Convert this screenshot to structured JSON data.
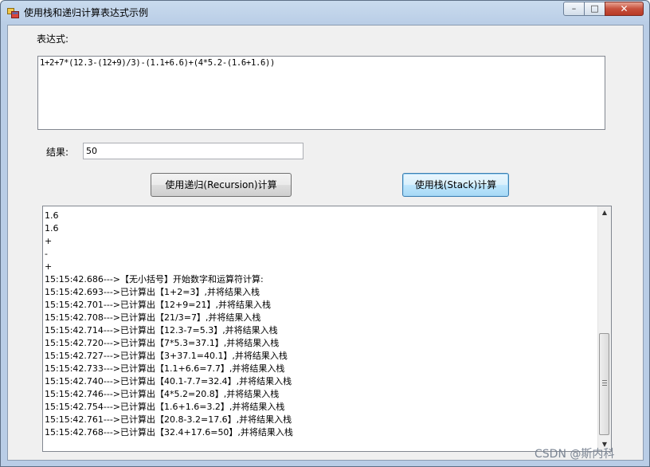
{
  "window": {
    "title": "使用栈和递归计算表达式示例",
    "controls": {
      "minimize": "–",
      "maximize": "□",
      "close": "✕"
    }
  },
  "expression": {
    "label": "表达式:",
    "value": "1+2+7*(12.3-(12+9)/3)-(1.1+6.6)+(4*5.2-(1.6+1.6))"
  },
  "result": {
    "label": "结果:",
    "value": "50"
  },
  "buttons": {
    "recursion": "使用递归(Recursion)计算",
    "stack": "使用栈(Stack)计算"
  },
  "log": {
    "lines": [
      "1.6",
      "1.6",
      "+",
      "-",
      "+",
      "15:15:42.686--->【无小括号】开始数字和运算符计算:",
      "15:15:42.693--->已计算出【1+2=3】,并将结果入栈",
      "15:15:42.701--->已计算出【12+9=21】,并将结果入栈",
      "15:15:42.708--->已计算出【21/3=7】,并将结果入栈",
      "15:15:42.714--->已计算出【12.3-7=5.3】,并将结果入栈",
      "15:15:42.720--->已计算出【7*5.3=37.1】,并将结果入栈",
      "15:15:42.727--->已计算出【3+37.1=40.1】,并将结果入栈",
      "15:15:42.733--->已计算出【1.1+6.6=7.7】,并将结果入栈",
      "15:15:42.740--->已计算出【40.1-7.7=32.4】,并将结果入栈",
      "15:15:42.746--->已计算出【4*5.2=20.8】,并将结果入栈",
      "15:15:42.754--->已计算出【1.6+1.6=3.2】,并将结果入栈",
      "15:15:42.761--->已计算出【20.8-3.2=17.6】,并将结果入栈",
      "15:15:42.768--->已计算出【32.4+17.6=50】,并将结果入栈"
    ]
  },
  "watermark": "CSDN @斯内科",
  "icons": {
    "app": "app-icon",
    "scroll_up": "scroll-up-arrow-icon",
    "scroll_down": "scroll-down-arrow-icon"
  },
  "colors": {
    "title_bar": "#b9cde6",
    "close_button": "#c7503c",
    "focused_button_border": "#3c7fb1"
  }
}
